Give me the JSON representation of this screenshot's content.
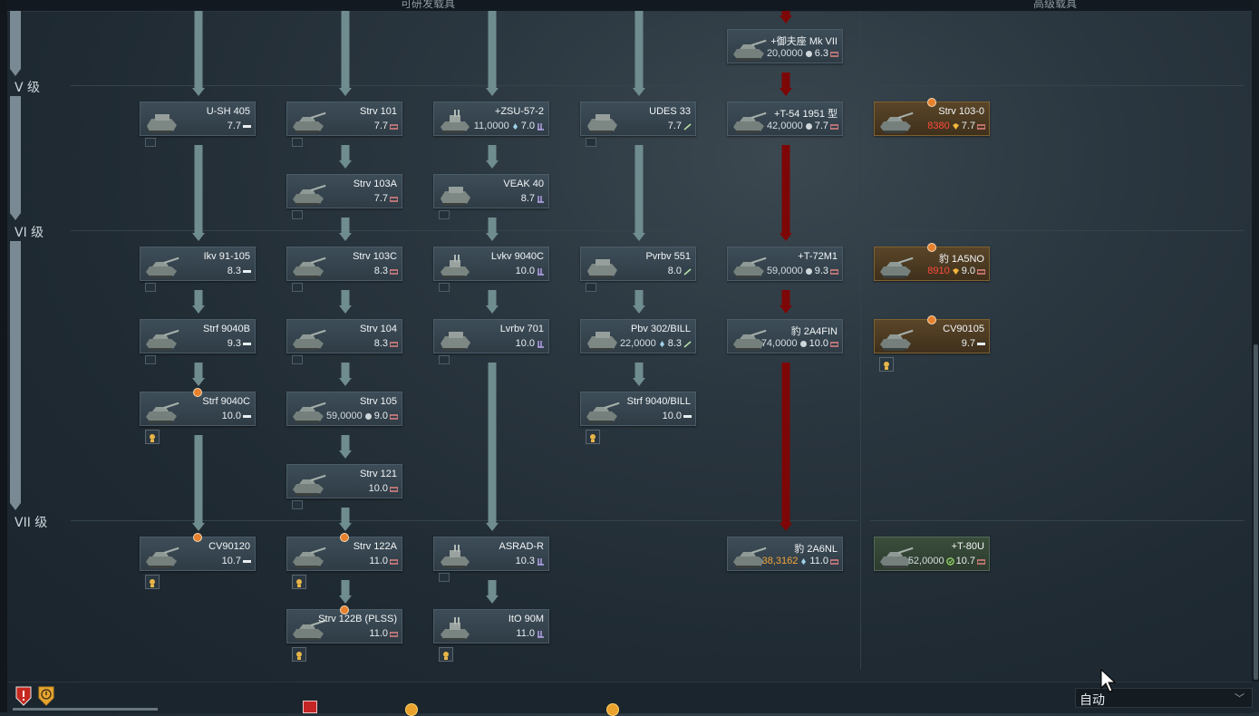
{
  "headers": {
    "researchable": "可研发载具",
    "premium": "高级载具"
  },
  "ranks": {
    "v": "V 级",
    "vi": "VI 级",
    "vii": "VII 级"
  },
  "vehicles": {
    "t90": {
      "name": "+御夫座 Mk VII",
      "cost": "20,0000",
      "br": "6.3"
    },
    "ush405": {
      "name": "U-SH 405",
      "br": "7.7"
    },
    "strv101": {
      "name": "Strv 101",
      "br": "7.7"
    },
    "zsu572": {
      "name": "+ZSU-57-2",
      "cost": "11,0000",
      "br": "7.0"
    },
    "udes33": {
      "name": "UDES 33",
      "br": "7.7"
    },
    "t541951": {
      "name": "+T-54 1951 型",
      "cost": "42,0000",
      "br": "7.7"
    },
    "strv1030": {
      "name": "Strv 103-0",
      "cost": "8380",
      "br": "7.7"
    },
    "strv103a": {
      "name": "Strv 103A",
      "br": "7.7"
    },
    "veak40": {
      "name": "VEAK 40",
      "br": "8.7"
    },
    "ikv91105": {
      "name": "Ikv 91-105",
      "br": "8.3"
    },
    "strv103c": {
      "name": "Strv 103C",
      "br": "8.3"
    },
    "lvkv9040c": {
      "name": "Lvkv 9040C",
      "br": "10.0"
    },
    "pvrbv551": {
      "name": "Pvrbv 551",
      "br": "8.0"
    },
    "t72m1": {
      "name": "+T-72M1",
      "cost": "59,0000",
      "br": "9.3"
    },
    "leo1a5no": {
      "name": "豹 1A5NO",
      "cost": "8910",
      "br": "9.0"
    },
    "strf9040b": {
      "name": "Strf 9040B",
      "br": "9.3"
    },
    "strv104": {
      "name": "Strv 104",
      "br": "8.3"
    },
    "lvrbv701": {
      "name": "Lvrbv 701",
      "br": "10.0"
    },
    "pbv302bill": {
      "name": "Pbv 302/BILL",
      "cost": "22,0000",
      "br": "8.3"
    },
    "leo2a4fin": {
      "name": "豹 2A4FIN",
      "cost": "74,0000",
      "br": "10.0"
    },
    "cv90105": {
      "name": "CV90105",
      "br": "9.7"
    },
    "strf9040c": {
      "name": "Strf 9040C",
      "br": "10.0"
    },
    "strv105": {
      "name": "Strv 105",
      "cost": "59,0000",
      "br": "9.0"
    },
    "strf9040bill": {
      "name": "Strf 9040/BILL",
      "br": "10.0"
    },
    "strv121": {
      "name": "Strv 121",
      "br": "10.0"
    },
    "cv90120": {
      "name": "CV90120",
      "br": "10.7"
    },
    "strv122a": {
      "name": "Strv 122A",
      "br": "11.0"
    },
    "asradr": {
      "name": "ASRAD-R",
      "br": "10.3"
    },
    "leo2a6nl": {
      "name": "豹 2A6NL",
      "cost": "38,3162",
      "br": "11.0"
    },
    "t80u": {
      "name": "+T-80U",
      "cost": "52,0000",
      "br": "10.7"
    },
    "strv122b": {
      "name": "Strv 122B (PLSS)",
      "br": "11.0"
    },
    "ito90m": {
      "name": "ItO 90M",
      "br": "11.0"
    }
  },
  "footer": {
    "select_value": "自动",
    "select_chevron": "﹀"
  },
  "colors": {
    "arrow_green": "#6f8c8f",
    "arrow_red": "#7d0707",
    "card_bg": "#34424c",
    "premium_bg": "#4f3d25",
    "accent_orange": "#e7812e"
  }
}
